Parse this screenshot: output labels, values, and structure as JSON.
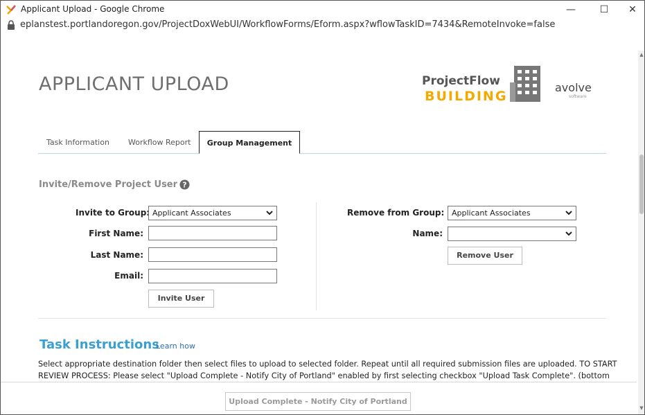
{
  "window": {
    "title": "Applicant Upload - Google Chrome",
    "minimize_glyph": "—",
    "maximize_glyph": "☐",
    "close_glyph": "✕"
  },
  "address_bar": {
    "url": "eplanstest.portlandoregon.gov/ProjectDoxWebUI/WorkflowForms/Eform.aspx?wflowTaskID=7434&RemoteInvoke=false"
  },
  "header": {
    "page_title": "APPLICANT UPLOAD",
    "logo_line1": "ProjectFlow",
    "logo_line2": "BUILDING",
    "avolve": "avolve",
    "avolve_sub": "software"
  },
  "tabs": [
    {
      "label": "Task Information"
    },
    {
      "label": "Workflow Report"
    },
    {
      "label": "Group Management"
    }
  ],
  "invite_section": {
    "heading": "Invite/Remove Project User",
    "invite_group_label": "Invite to Group:",
    "invite_group_value": "Applicant Associates",
    "first_name_label": "First Name:",
    "first_name_value": "",
    "last_name_label": "Last Name:",
    "last_name_value": "",
    "email_label": "Email:",
    "email_value": "",
    "invite_button": "Invite User",
    "remove_group_label": "Remove from Group:",
    "remove_group_value": "Applicant Associates",
    "name_label": "Name:",
    "name_value": "",
    "remove_button": "Remove User"
  },
  "task_instructions": {
    "heading": "Task Instructions",
    "learn_link": "Learn how",
    "body": "Select appropriate destination folder then select files to upload to selected folder. Repeat until all required submission files are uploaded. TO START REVIEW PROCESS: Please select \"Upload Complete - Notify City of Portland\" enabled by first selecting checkbox \"Upload Task Complete\". (bottom of"
  },
  "footer": {
    "complete_button": "Upload Complete - Notify City of Portland"
  },
  "colors": {
    "accent_blue": "#3a9fd2",
    "brand_orange": "#f2a900",
    "tab_underline": "#b7dbe6"
  }
}
